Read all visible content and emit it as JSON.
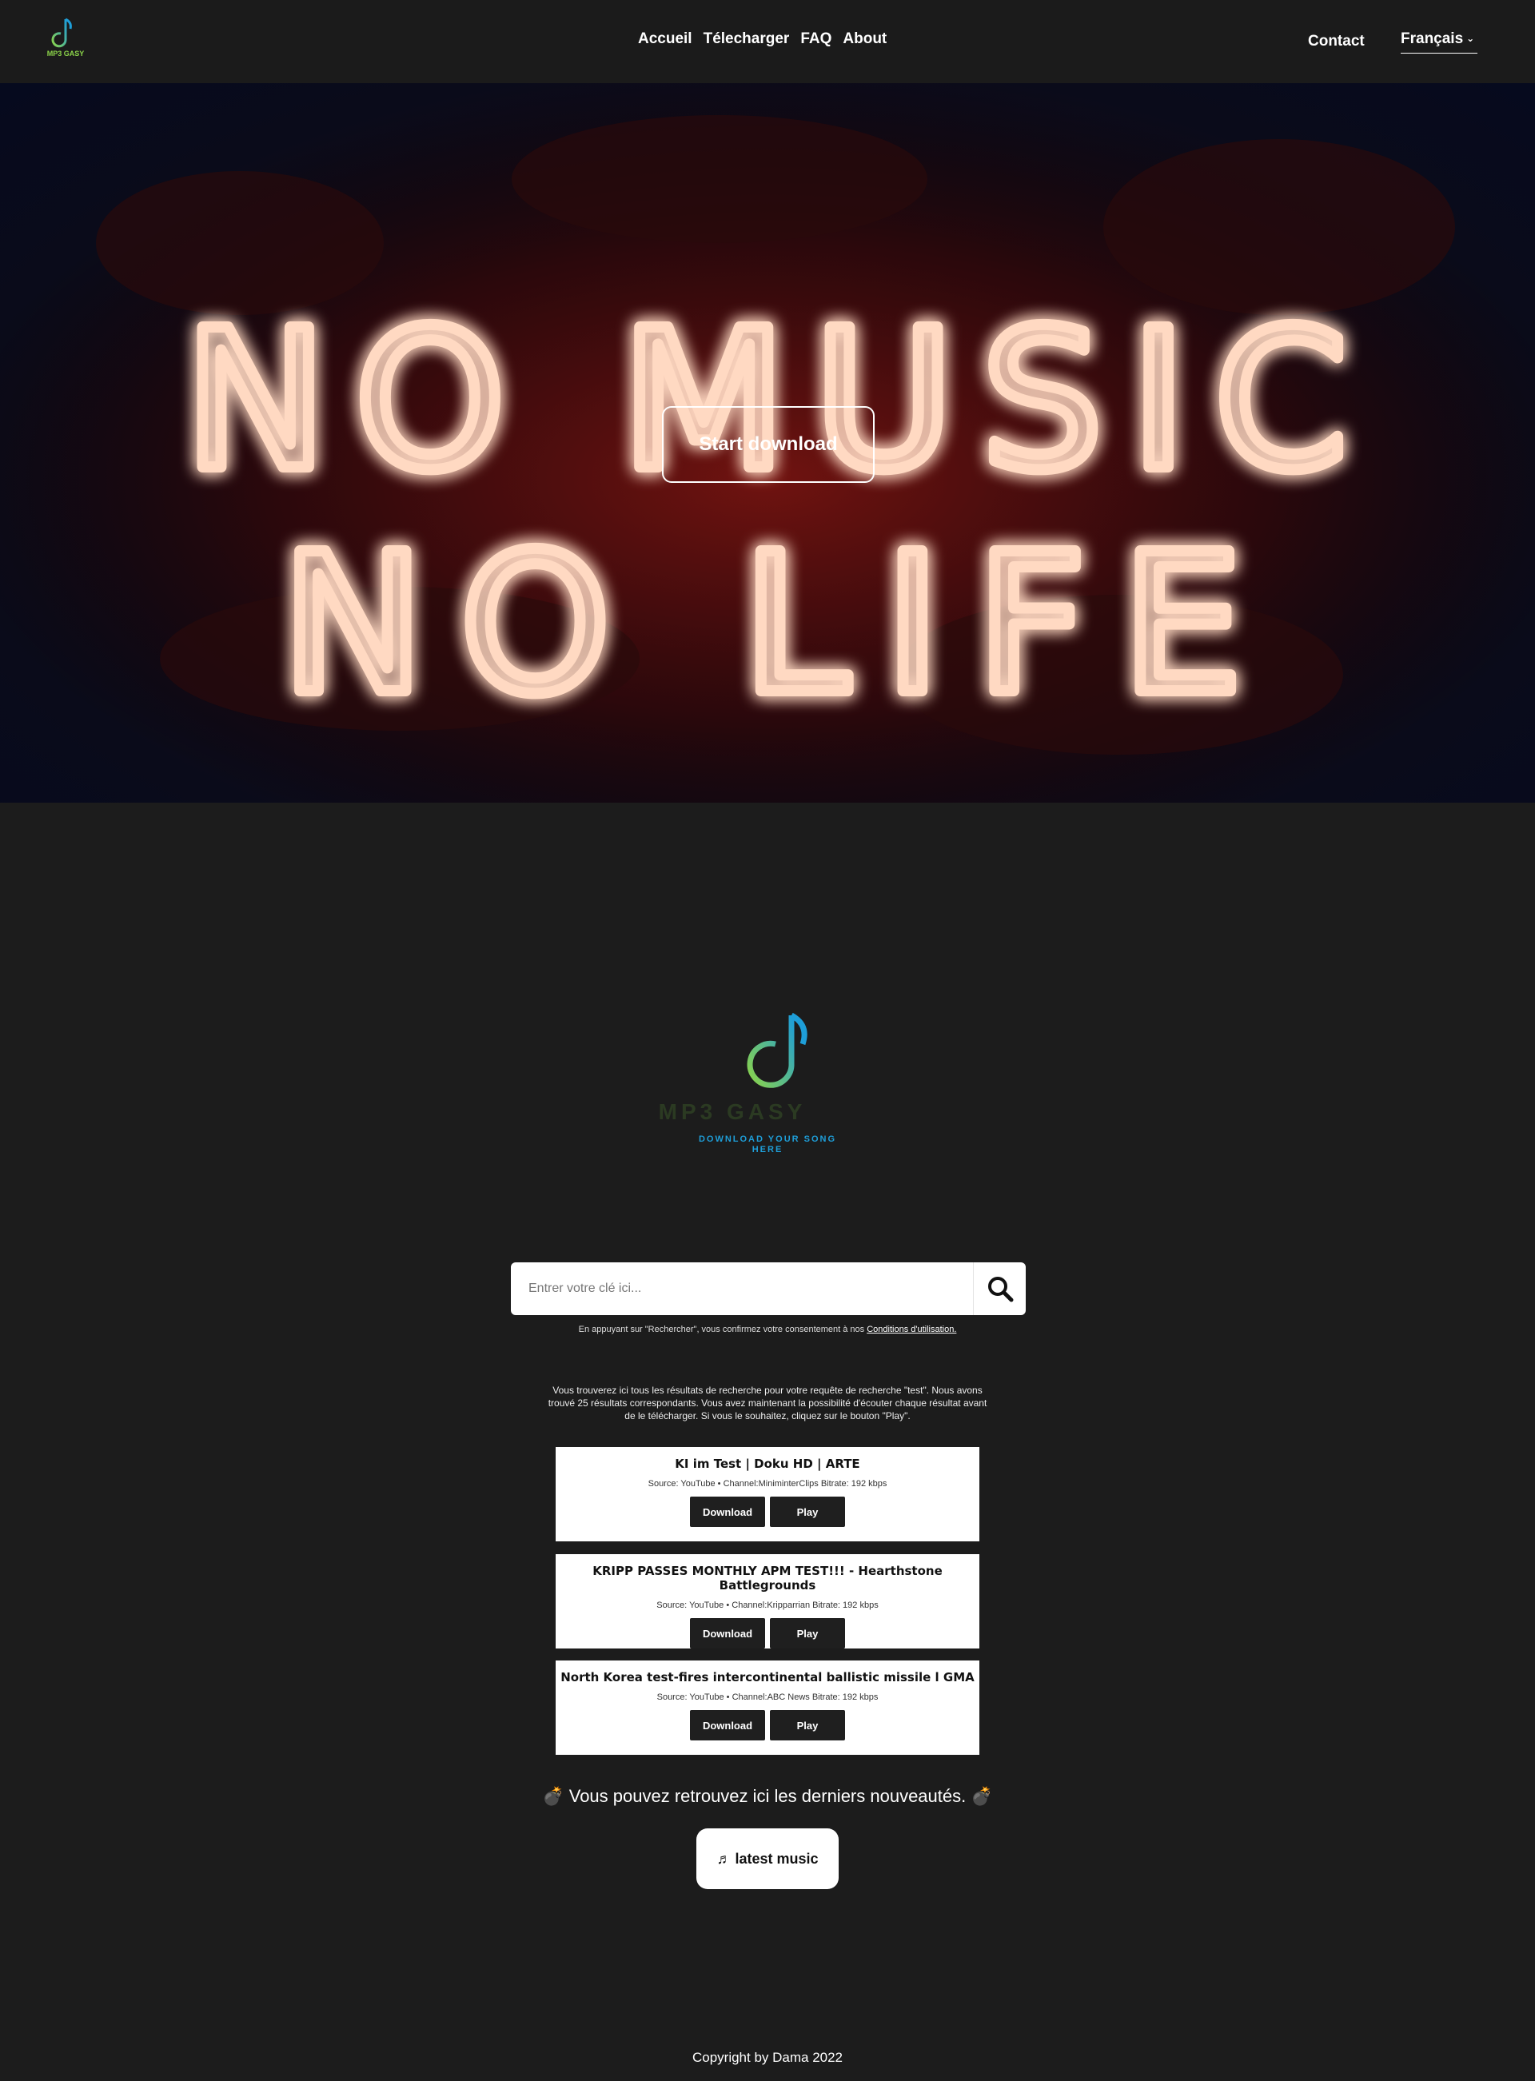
{
  "nav": {
    "logo_text": "MP3 GASY",
    "links": [
      {
        "label": "Accueil"
      },
      {
        "label": "Télecharger"
      },
      {
        "label": "FAQ"
      },
      {
        "label": "About"
      }
    ],
    "contact": "Contact",
    "language": "Français"
  },
  "hero": {
    "neon_line1": "NO MUSIC",
    "neon_line2": "NO LIFE",
    "cta": "Start download"
  },
  "logo": {
    "name": "MP3 GASY",
    "tagline_line1": "DOWNLOAD YOUR SONG",
    "tagline_line2": "HERE"
  },
  "search": {
    "placeholder": "Entrer votre clé ici...",
    "consent_text": "En appuyant sur \"Rechercher\", vous confirmez votre consentement à nos ",
    "consent_link": "Conditions d'utilisation."
  },
  "intro": "Vous trouverez ici tous les résultats de recherche pour votre requête de recherche \"test\". Nous avons trouvé 25 résultats correspondants. Vous avez maintenant la possibilité d'écouter chaque résultat avant de le télécharger. Si vous le souhaitez, cliquez sur le bouton \"Play\".",
  "results": [
    {
      "title": "KI im Test | Doku HD | ARTE",
      "meta": "Source: YouTube • Channel:MiniminterClips Bitrate: 192 kbps",
      "download": "Download",
      "play": "Play"
    },
    {
      "title": "KRIPP PASSES MONTHLY APM TEST!!! - Hearthstone Battlegrounds",
      "meta": "Source: YouTube • Channel:Kripparrian Bitrate: 192 kbps",
      "download": "Download",
      "play": "Play"
    },
    {
      "title": "North Korea test-fires intercontinental ballistic missile l GMA",
      "meta": "Source: YouTube • Channel:ABC News Bitrate: 192 kbps",
      "download": "Download",
      "play": "Play"
    }
  ],
  "news": "Vous pouvez retrouvez ici les derniers nouveautés.",
  "latest_button": "latest music",
  "footer": "Copyright by Dama 2022",
  "colors": {
    "background": "#1c1c1c",
    "neon_glow": "#ff3a1a",
    "logo_gradient_start": "#8bd34a",
    "logo_gradient_end": "#1e9ed8"
  }
}
